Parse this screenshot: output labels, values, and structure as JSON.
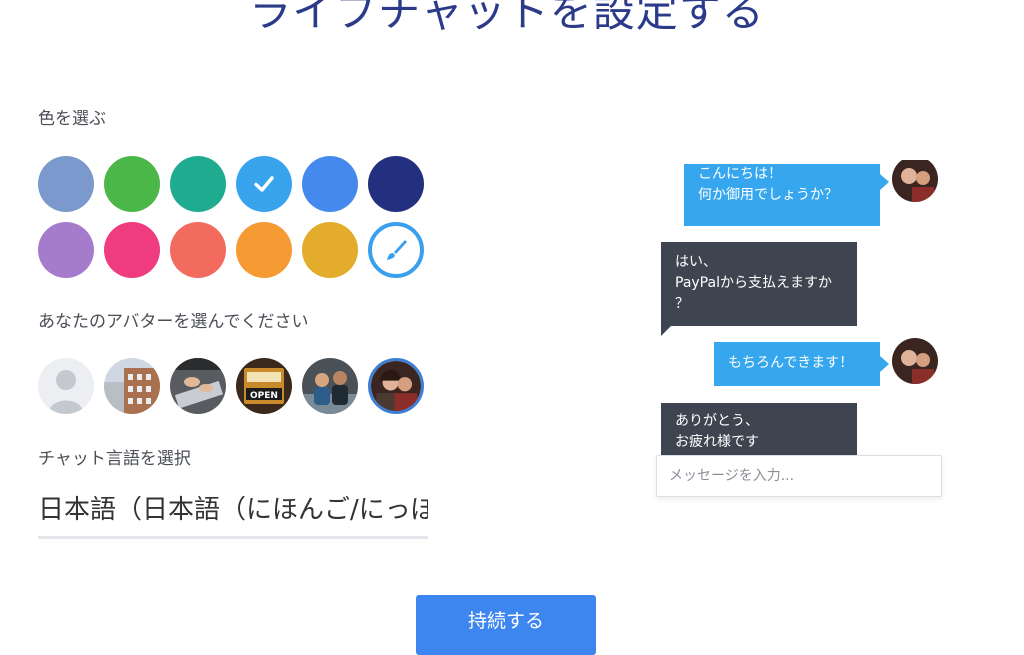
{
  "page": {
    "title": "ライブチャットを設定する"
  },
  "color_section": {
    "label": "色を選ぶ",
    "swatches": [
      {
        "color": "#7b99cc",
        "selected": false
      },
      {
        "color": "#4bb748",
        "selected": false
      },
      {
        "color": "#1fab8f",
        "selected": false
      },
      {
        "color": "#38a4ee",
        "selected": true
      },
      {
        "color": "#4589ee",
        "selected": false
      },
      {
        "color": "#23307f",
        "selected": false
      },
      {
        "color": "#a57bcb",
        "selected": false
      },
      {
        "color": "#ef3c7f",
        "selected": false
      },
      {
        "color": "#f26b5e",
        "selected": false
      },
      {
        "color": "#f69a33",
        "selected": false
      },
      {
        "color": "#e3ac2a",
        "selected": false
      },
      {
        "color": "#ffffff",
        "custom": true,
        "icon": "paintbrush-icon"
      }
    ]
  },
  "avatar_section": {
    "label": "あなたのアバターを選んでください",
    "avatars": [
      "default-silhouette",
      "building",
      "laptop",
      "open-sign",
      "people",
      "couple-photo"
    ],
    "selected_index": 5
  },
  "language_section": {
    "label": "チャット言語を選択",
    "selected_value": "日本語（日本語（にほんご/にっぽ"
  },
  "continue_button": {
    "label": "持続する"
  },
  "chat_preview": {
    "messages": [
      {
        "from": "agent",
        "text": "こんにちは！\n何か御用でしょうか？"
      },
      {
        "from": "visitor",
        "text": "はい、\nPayPalから支払えますか\n？"
      },
      {
        "from": "agent",
        "text": "もちろんできます！"
      },
      {
        "from": "visitor",
        "text": "ありがとう、\nお疲れ様です"
      }
    ],
    "input_placeholder": "メッセージを入力..."
  }
}
